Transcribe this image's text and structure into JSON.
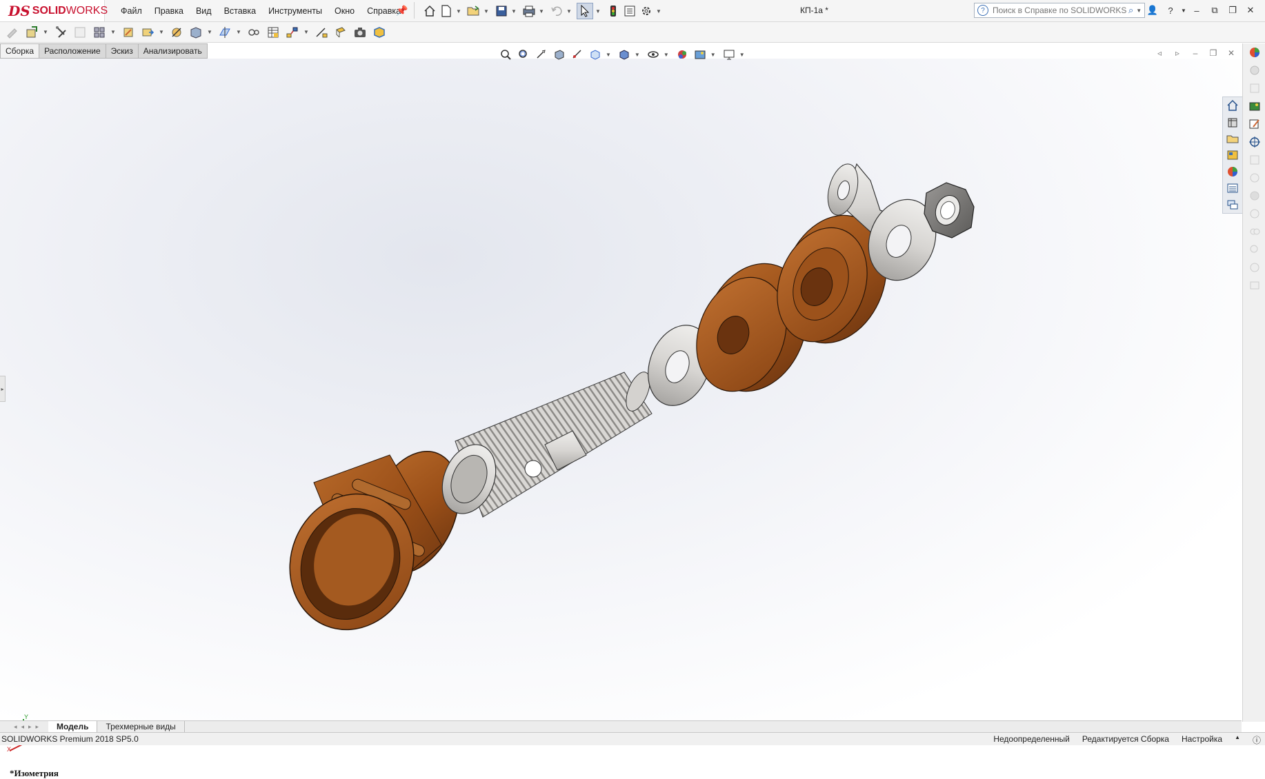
{
  "app": {
    "brand_prefix": "DS",
    "brand_bold": "SOLID",
    "brand_light": "WORKS",
    "doc_title": "КП-1а *"
  },
  "menu": [
    "Файл",
    "Правка",
    "Вид",
    "Вставка",
    "Инструменты",
    "Окно",
    "Справка"
  ],
  "search": {
    "placeholder": "Поиск в Справке по SOLIDWORKS"
  },
  "command_tabs": [
    "Сборка",
    "Расположение",
    "Эскиз",
    "Анализировать"
  ],
  "quick_access_icons": [
    "home-icon",
    "new-document-icon",
    "open-folder-icon",
    "save-icon",
    "print-icon",
    "undo-icon",
    "select-pointer-icon",
    "traffic-light-icon",
    "file-properties-icon",
    "options-gear-icon"
  ],
  "toolbar_icons": [
    "edit-component-icon",
    "insert-components-icon",
    "mate-icon",
    "linear-pattern-icon",
    "smart-fasteners-icon",
    "move-component-icon",
    "show-hidden-icon",
    "assembly-features-icon",
    "reference-geometry-icon",
    "new-motion-study-icon",
    "bill-of-materials-icon",
    "exploded-view-icon",
    "explode-line-sketch-icon",
    "instant3d-icon",
    "snapshot-icon",
    "update-speedpak-icon"
  ],
  "headsup_icons": [
    "zoom-to-fit-icon",
    "zoom-to-area-icon",
    "previous-view-icon",
    "section-view-icon",
    "dynamic-annotation-icon",
    "view-orientation-icon",
    "display-style-icon",
    "hide-show-items-icon",
    "edit-appearance-icon",
    "apply-scene-icon",
    "view-settings-icon"
  ],
  "taskpane_icons": [
    "sw-resources-icon",
    "design-library-icon",
    "file-explorer-icon",
    "view-palette-icon",
    "appearances-icon",
    "custom-properties-icon",
    "forum-icon"
  ],
  "view_name": "*Изометрия",
  "bottom_tabs": [
    "Модель",
    "Трехмерные виды"
  ],
  "status": {
    "product": "SOLIDWORKS Premium 2018 SP5.0",
    "definition": "Недоопределенный",
    "editing": "Редактируется Сборка",
    "customize": "Настройка"
  },
  "colors": {
    "brand": "#c8102e",
    "copper": "#a4561c",
    "steel": "#d8d6d3",
    "background_top": "#e3e6ee"
  }
}
